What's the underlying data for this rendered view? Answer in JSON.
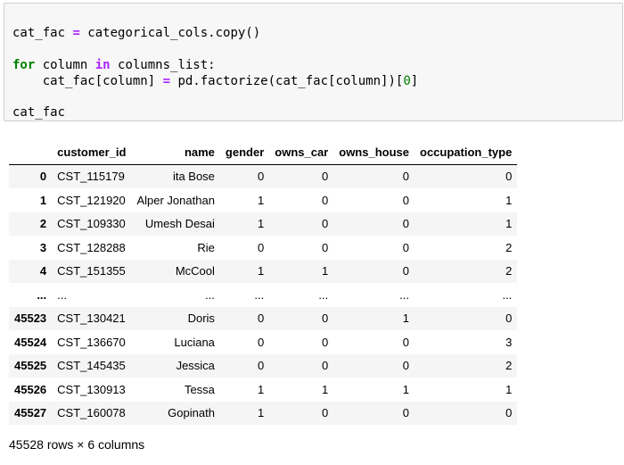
{
  "code": {
    "line1": {
      "a": "cat_fac ",
      "op": "=",
      "b": " categorical_cols.copy()"
    },
    "line2": {
      "kw1": "for",
      "a": " column ",
      "kw2": "in",
      "b": " columns_list:"
    },
    "line3": {
      "a": "    cat_fac[column] ",
      "op": "=",
      "b": " pd.factorize(cat_fac[column])[",
      "num": "0",
      "c": "]"
    },
    "line4": {
      "a": "cat_fac"
    }
  },
  "table": {
    "columns": [
      "",
      "customer_id",
      "name",
      "gender",
      "owns_car",
      "owns_house",
      "occupation_type"
    ],
    "rows": [
      [
        "0",
        "CST_115179",
        "ita Bose",
        "0",
        "0",
        "0",
        "0"
      ],
      [
        "1",
        "CST_121920",
        "Alper Jonathan",
        "1",
        "0",
        "0",
        "1"
      ],
      [
        "2",
        "CST_109330",
        "Umesh Desai",
        "1",
        "0",
        "0",
        "1"
      ],
      [
        "3",
        "CST_128288",
        "Rie",
        "0",
        "0",
        "0",
        "2"
      ],
      [
        "4",
        "CST_151355",
        "McCool",
        "1",
        "1",
        "0",
        "2"
      ],
      [
        "...",
        "...",
        "...",
        "...",
        "...",
        "...",
        "..."
      ],
      [
        "45523",
        "CST_130421",
        "Doris",
        "0",
        "0",
        "1",
        "0"
      ],
      [
        "45524",
        "CST_136670",
        "Luciana",
        "0",
        "0",
        "0",
        "3"
      ],
      [
        "45525",
        "CST_145435",
        "Jessica",
        "0",
        "0",
        "0",
        "2"
      ],
      [
        "45526",
        "CST_130913",
        "Tessa",
        "1",
        "1",
        "1",
        "1"
      ],
      [
        "45527",
        "CST_160078",
        "Gopinath",
        "1",
        "0",
        "0",
        "0"
      ]
    ]
  },
  "shape_text": "45528 rows × 6 columns"
}
